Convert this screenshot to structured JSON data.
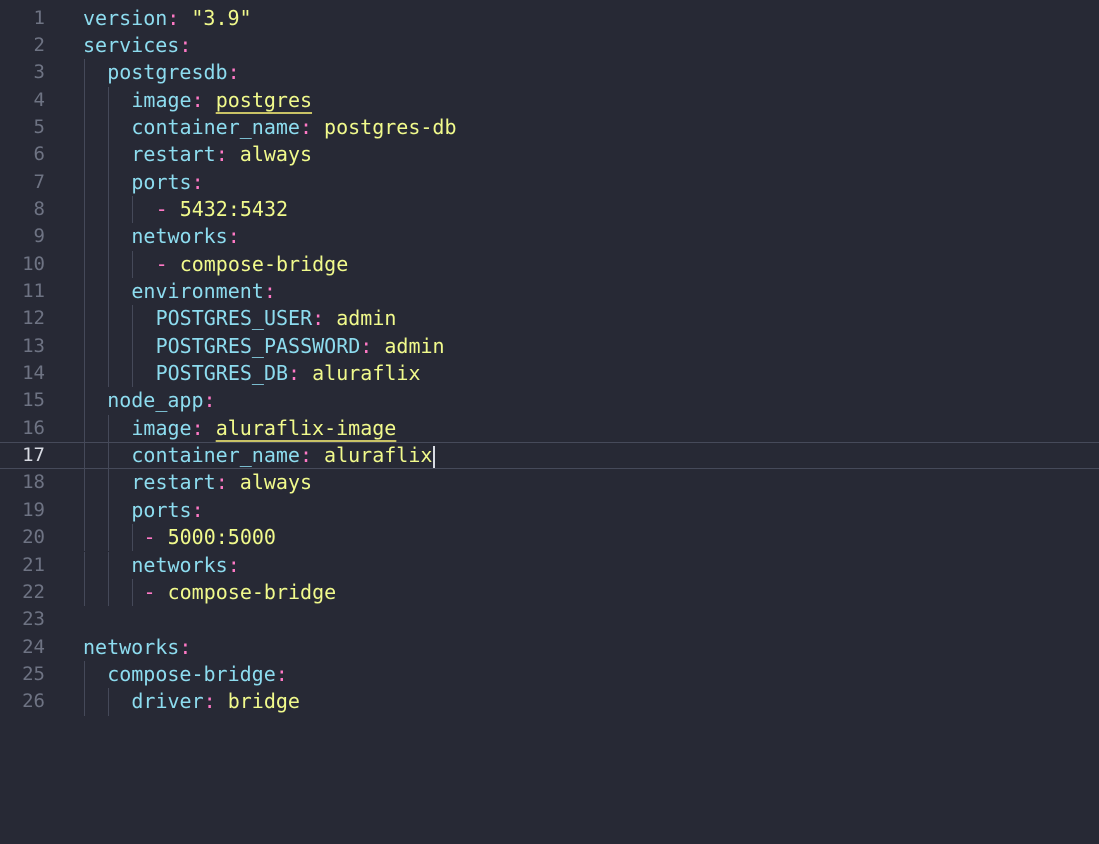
{
  "editor": {
    "current_line": 17,
    "lines": [
      {
        "n": "1",
        "indent": 0,
        "key": "version",
        "colon": ":",
        "val": " \"3.9\"",
        "guides": []
      },
      {
        "n": "2",
        "indent": 0,
        "key": "services",
        "colon": ":",
        "val": "",
        "guides": []
      },
      {
        "n": "3",
        "indent": 1,
        "key": "postgresdb",
        "colon": ":",
        "val": "",
        "guides": [
          0
        ]
      },
      {
        "n": "4",
        "indent": 2,
        "key": "image",
        "colon": ":",
        "val": "postgres",
        "underline": true,
        "guides": [
          0,
          1
        ]
      },
      {
        "n": "5",
        "indent": 2,
        "key": "container_name",
        "colon": ":",
        "val": " postgres-db",
        "guides": [
          0,
          1
        ]
      },
      {
        "n": "6",
        "indent": 2,
        "key": "restart",
        "colon": ":",
        "val": " always",
        "guides": [
          0,
          1
        ]
      },
      {
        "n": "7",
        "indent": 2,
        "key": "ports",
        "colon": ":",
        "val": "",
        "guides": [
          0,
          1
        ]
      },
      {
        "n": "8",
        "indent": 3,
        "dash": "- ",
        "val": "5432:5432",
        "guides": [
          0,
          1,
          2
        ]
      },
      {
        "n": "9",
        "indent": 2,
        "key": "networks",
        "colon": ":",
        "val": "",
        "guides": [
          0,
          1
        ]
      },
      {
        "n": "10",
        "indent": 3,
        "dash": "- ",
        "val": "compose-bridge",
        "guides": [
          0,
          1,
          2
        ]
      },
      {
        "n": "11",
        "indent": 2,
        "key": "environment",
        "colon": ":",
        "val": "",
        "guides": [
          0,
          1
        ]
      },
      {
        "n": "12",
        "indent": 3,
        "key": "POSTGRES_USER",
        "colon": ":",
        "val": " admin",
        "guides": [
          0,
          1,
          2
        ]
      },
      {
        "n": "13",
        "indent": 3,
        "key": "POSTGRES_PASSWORD",
        "colon": ":",
        "val": " admin",
        "guides": [
          0,
          1,
          2
        ]
      },
      {
        "n": "14",
        "indent": 3,
        "key": "POSTGRES_DB",
        "colon": ":",
        "val": " aluraflix",
        "guides": [
          0,
          1,
          2
        ]
      },
      {
        "n": "15",
        "indent": 1,
        "key": "node_app",
        "colon": ":",
        "val": "",
        "guides": [
          0
        ]
      },
      {
        "n": "16",
        "indent": 2,
        "key": "image",
        "colon": ":",
        "val": "aluraflix-image",
        "underline": true,
        "guides": [
          0,
          1
        ]
      },
      {
        "n": "17",
        "indent": 2,
        "key": "container_name",
        "colon": ":",
        "val": " aluraflix",
        "cursor": true,
        "guides": [
          0,
          1
        ]
      },
      {
        "n": "18",
        "indent": 2,
        "key": "restart",
        "colon": ":",
        "val": " always",
        "guides": [
          0,
          1
        ]
      },
      {
        "n": "19",
        "indent": 2,
        "key": "ports",
        "colon": ":",
        "val": "",
        "guides": [
          0,
          1
        ]
      },
      {
        "n": "20",
        "indent": 2.5,
        "dash": "- ",
        "val": "5000:5000",
        "guides": [
          0,
          1,
          2
        ]
      },
      {
        "n": "21",
        "indent": 2,
        "key": "networks",
        "colon": ":",
        "val": "",
        "guides": [
          0,
          1
        ]
      },
      {
        "n": "22",
        "indent": 2.5,
        "dash": "- ",
        "val": "compose-bridge",
        "guides": [
          0,
          1,
          2
        ]
      },
      {
        "n": "23",
        "indent": 0,
        "val": "",
        "guides": []
      },
      {
        "n": "24",
        "indent": 0,
        "key": "networks",
        "colon": ":",
        "val": "",
        "guides": []
      },
      {
        "n": "25",
        "indent": 1,
        "key": "compose-bridge",
        "colon": ":",
        "val": "",
        "guides": [
          0
        ]
      },
      {
        "n": "26",
        "indent": 2,
        "key": "driver",
        "colon": ":",
        "val": " bridge",
        "guides": [
          0,
          1
        ]
      }
    ]
  }
}
